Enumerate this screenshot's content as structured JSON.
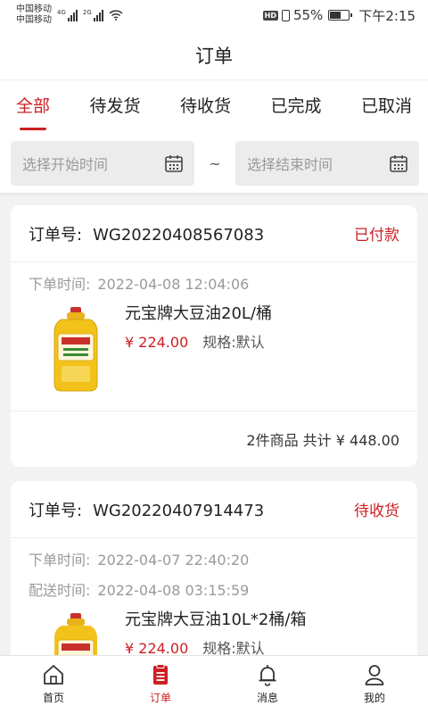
{
  "status_bar": {
    "carrier_1": "中国移动",
    "carrier_2": "中国移动",
    "net_1": "4G",
    "net_2": "2G",
    "battery_text": "55%",
    "battery_level": 0.55,
    "time": "下午2:15",
    "hd_label": "HD"
  },
  "header": {
    "title": "订单"
  },
  "tabs": [
    {
      "label": "全部",
      "active": true
    },
    {
      "label": "待发货",
      "active": false
    },
    {
      "label": "待收货",
      "active": false
    },
    {
      "label": "已完成",
      "active": false
    },
    {
      "label": "已取消",
      "active": false
    }
  ],
  "date_filter": {
    "start_placeholder": "选择开始时间",
    "separator": "~",
    "end_placeholder": "选择结束时间",
    "icon": "calendar-icon"
  },
  "orders": [
    {
      "order_no_label": "订单号:",
      "order_no": "WG20220408567083",
      "status": "已付款",
      "placed_label": "下单时间:",
      "placed_time": "2022-04-08 12:04:06",
      "product_name": "元宝牌大豆油20L/桶",
      "price": "¥ 224.00",
      "spec": "规格:默认",
      "summary": "2件商品 共计 ¥ 448.00"
    },
    {
      "order_no_label": "订单号:",
      "order_no": "WG20220407914473",
      "status": "待收货",
      "placed_label": "下单时间:",
      "placed_time": "2022-04-07 22:40:20",
      "delivery_label": "配送时间:",
      "delivery_time": "2022-04-08 03:15:59",
      "product_name": "元宝牌大豆油10L*2桶/箱",
      "price": "¥ 224.00",
      "spec": "规格:默认"
    }
  ],
  "bottom_nav": [
    {
      "label": "首页",
      "icon": "home-icon",
      "active": false
    },
    {
      "label": "订单",
      "icon": "order-list-icon",
      "active": true
    },
    {
      "label": "消息",
      "icon": "bell-icon",
      "active": false
    },
    {
      "label": "我的",
      "icon": "user-icon",
      "active": false
    }
  ],
  "colors": {
    "accent": "#cc1f23",
    "muted_text": "#9a9a9a",
    "background": "#f2f2f2"
  }
}
